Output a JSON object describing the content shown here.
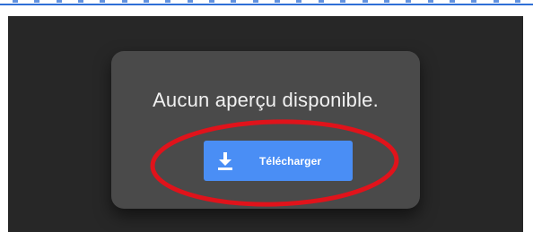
{
  "viewer": {
    "message": "Aucun aperçu disponible.",
    "download_button": {
      "label": "Télécharger",
      "icon": "download-icon"
    }
  },
  "colors": {
    "viewer_background": "#272727",
    "card_background": "#4a4a4a",
    "button": "#4a8ef5",
    "annotation": "#e0131b",
    "top_border": "#2f6fd6"
  },
  "annotation": {
    "shape": "ellipse",
    "target": "download-button"
  }
}
